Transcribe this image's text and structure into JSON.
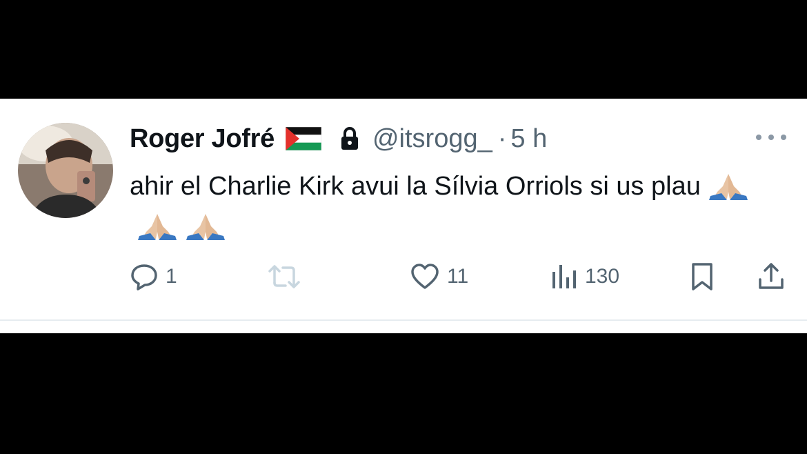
{
  "tweet": {
    "display_name": "Roger Jofré",
    "handle": "@itsrogg_",
    "separator": "·",
    "time": "5 h",
    "text": "ahir el Charlie Kirk avui la Sílvia Orriols si us plau",
    "emoji_count": 3,
    "flag_icon": "palestine-flag-icon",
    "locked": true
  },
  "actions": {
    "reply_count": "1",
    "retweet_count": "",
    "like_count": "11",
    "views_count": "130"
  },
  "colors": {
    "text": "#0f1419",
    "secondary": "#536471",
    "action_icon": "#536471",
    "retweet_disabled": "#c8d6df"
  }
}
